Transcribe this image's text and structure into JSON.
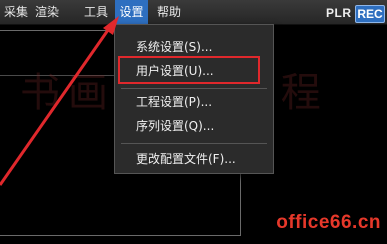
{
  "menubar": {
    "items": [
      {
        "label": "采集"
      },
      {
        "label": "渲染"
      },
      {
        "label": "工具"
      },
      {
        "label": "设置"
      },
      {
        "label": "帮助"
      }
    ],
    "logo_left": "PLR",
    "logo_right": "REC"
  },
  "settings_menu": {
    "items": [
      {
        "label": "系统设置(S)..."
      },
      {
        "label": "用户设置(U)..."
      },
      {
        "label": "工程设置(P)..."
      },
      {
        "label": "序列设置(Q)..."
      },
      {
        "label": "更改配置文件(F)..."
      }
    ]
  },
  "watermark": "office66.cn",
  "colors": {
    "menu_active": "#2e6fc0",
    "annotation_red": "#e0282c",
    "watermark_red": "#e6382a"
  }
}
